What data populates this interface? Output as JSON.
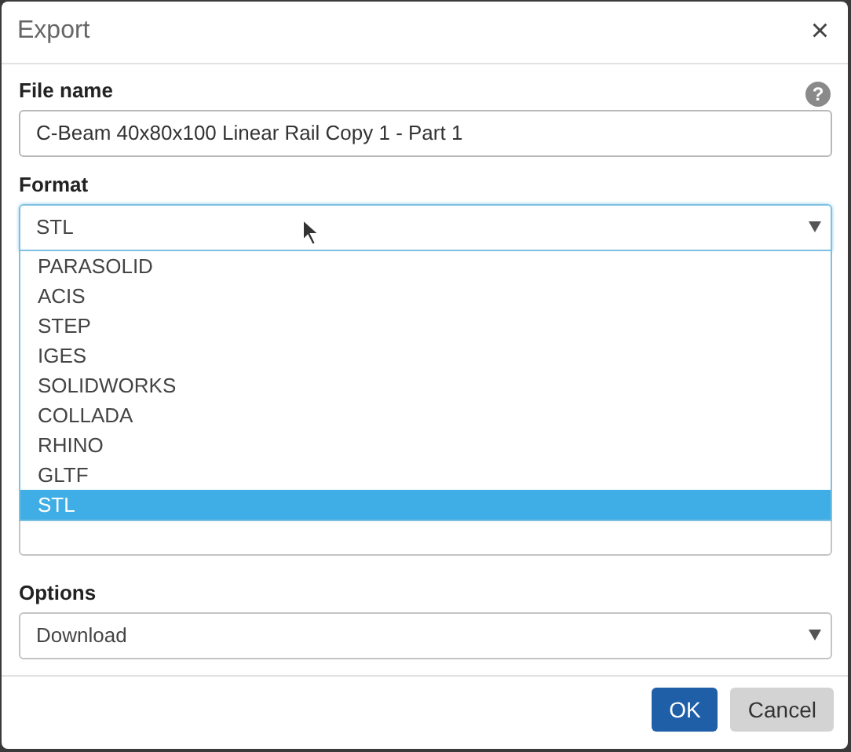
{
  "dialog": {
    "title": "Export",
    "close": "×"
  },
  "fields": [
    {
      "kind": "text",
      "label": "File name",
      "help": "?",
      "value": "C-Beam 40x80x100 Linear Rail Copy 1 - Part 1"
    },
    {
      "kind": "select",
      "label": "Format",
      "value": "STL",
      "focused": true,
      "open": true,
      "options": [
        {
          "label": "PARASOLID",
          "selected": false
        },
        {
          "label": "ACIS",
          "selected": false
        },
        {
          "label": "STEP",
          "selected": false
        },
        {
          "label": "IGES",
          "selected": false
        },
        {
          "label": "SOLIDWORKS",
          "selected": false
        },
        {
          "label": "COLLADA",
          "selected": false
        },
        {
          "label": "RHINO",
          "selected": false
        },
        {
          "label": "GLTF",
          "selected": false
        },
        {
          "label": "STL",
          "selected": true
        }
      ]
    },
    {
      "kind": "hidden"
    },
    {
      "kind": "select",
      "label": "Options",
      "value": "Download",
      "focused": false,
      "open": false
    }
  ],
  "buttons": [
    {
      "label": "OK",
      "kind": "primary"
    },
    {
      "label": "Cancel",
      "kind": "secondary"
    }
  ]
}
